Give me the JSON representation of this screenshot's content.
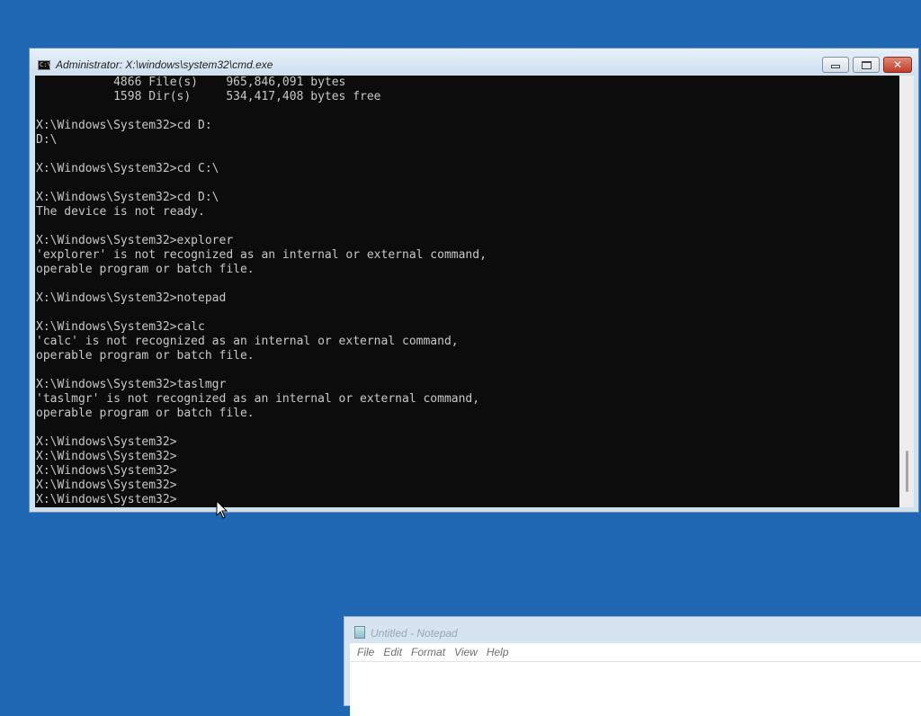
{
  "cmd_window": {
    "title": "Administrator: X:\\windows\\system32\\cmd.exe",
    "icon_text": "C:\\",
    "close_glyph": "✕",
    "lines": [
      "           4866 File(s)    965,846,091 bytes",
      "           1598 Dir(s)     534,417,408 bytes free",
      "",
      "X:\\Windows\\System32>cd D:",
      "D:\\",
      "",
      "X:\\Windows\\System32>cd C:\\",
      "",
      "X:\\Windows\\System32>cd D:\\",
      "The device is not ready.",
      "",
      "X:\\Windows\\System32>explorer",
      "'explorer' is not recognized as an internal or external command,",
      "operable program or batch file.",
      "",
      "X:\\Windows\\System32>notepad",
      "",
      "X:\\Windows\\System32>calc",
      "'calc' is not recognized as an internal or external command,",
      "operable program or batch file.",
      "",
      "X:\\Windows\\System32>taslmgr",
      "'taslmgr' is not recognized as an internal or external command,",
      "operable program or batch file.",
      "",
      "X:\\Windows\\System32>",
      "X:\\Windows\\System32>",
      "X:\\Windows\\System32>",
      "X:\\Windows\\System32>",
      "X:\\Windows\\System32>"
    ]
  },
  "notepad_window": {
    "title": "Untitled - Notepad",
    "menu": [
      "File",
      "Edit",
      "Format",
      "View",
      "Help"
    ]
  },
  "colors": {
    "desktop": "#1f66b3",
    "console_bg": "#0c0c0c",
    "console_text": "#c8c8c8"
  },
  "icons": {
    "cmd": "cmd-icon",
    "notepad": "notepad-icon",
    "pointer": "mouse-pointer-icon"
  }
}
